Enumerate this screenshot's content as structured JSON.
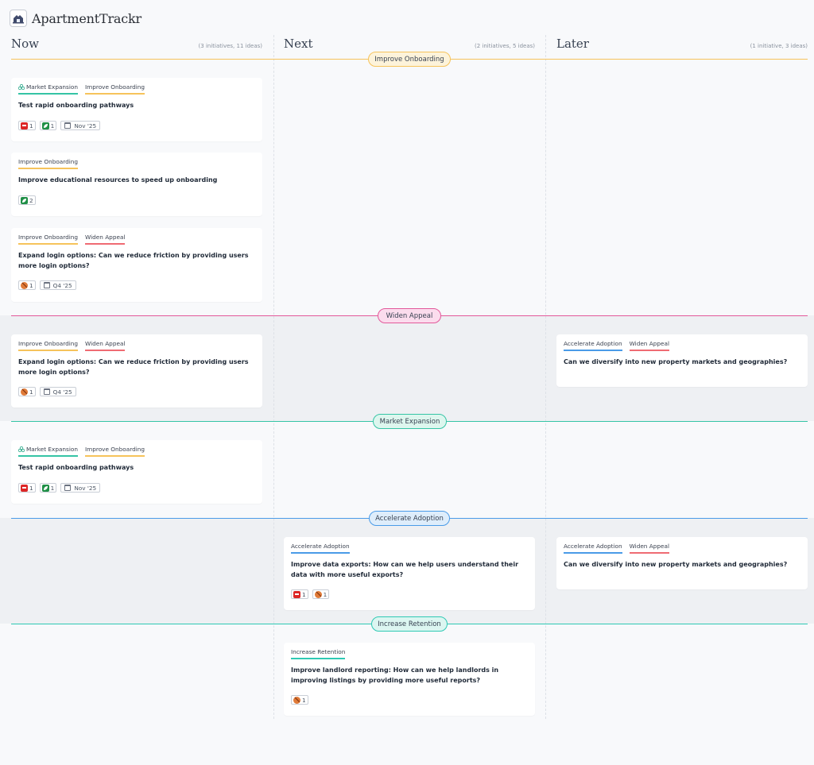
{
  "app": {
    "title": "ApartmentTrackr",
    "logo_icon": "apartment-logo-icon"
  },
  "columns": [
    {
      "title": "Now",
      "summary": "(3 initiatives, 11 ideas)"
    },
    {
      "title": "Next",
      "summary": "(2 initiatives, 5 ideas)"
    },
    {
      "title": "Later",
      "summary": "(1 initiative, 3 ideas)"
    }
  ],
  "colors": {
    "improve_onboarding": "#f6c35b",
    "widen_appeal": "#ef6b73",
    "market_expansion": "#35c4a5",
    "accelerate_adoption": "#4a9be8",
    "increase_retention": "#2ec9b4",
    "blocked": "#dc2626",
    "in_progress": "#1f8f46",
    "risk": "#e07b39"
  },
  "lanes": [
    {
      "label": "Improve Onboarding"
    },
    {
      "label": "Widen Appeal"
    },
    {
      "label": "Market Expansion"
    },
    {
      "label": "Accelerate Adoption"
    },
    {
      "label": "Increase Retention"
    }
  ],
  "cards": [
    {
      "tags": [
        "Market Expansion",
        "Improve Onboarding"
      ],
      "title": "Test rapid onboarding pathways",
      "badges": [
        {
          "icon": "blocked-icon",
          "count": "1"
        },
        {
          "icon": "leaf-icon",
          "count": "1"
        },
        {
          "icon": "calendar-icon",
          "text": "Nov '25"
        }
      ]
    },
    {
      "tags": [
        "Improve Onboarding"
      ],
      "title": "Improve educational resources to speed up onboarding",
      "badges": [
        {
          "icon": "leaf-icon",
          "count": "2"
        }
      ]
    },
    {
      "tags": [
        "Improve Onboarding",
        "Widen Appeal"
      ],
      "title": "Expand login options: Can we reduce friction by providing users more login options?",
      "badges": [
        {
          "icon": "ball-icon",
          "count": "1"
        },
        {
          "icon": "calendar-icon",
          "text": "Q4 '25"
        }
      ]
    },
    {
      "tags": [
        "Improve Onboarding",
        "Widen Appeal"
      ],
      "title": "Expand login options: Can we reduce friction by providing users more login options?",
      "badges": [
        {
          "icon": "ball-icon",
          "count": "1"
        },
        {
          "icon": "calendar-icon",
          "text": "Q4 '25"
        }
      ]
    },
    {
      "tags": [
        "Accelerate Adoption",
        "Widen Appeal"
      ],
      "title": "Can we diversify into new property markets and geographies?",
      "badges": []
    },
    {
      "tags": [
        "Market Expansion",
        "Improve Onboarding"
      ],
      "title": "Test rapid onboarding pathways",
      "badges": [
        {
          "icon": "blocked-icon",
          "count": "1"
        },
        {
          "icon": "leaf-icon",
          "count": "1"
        },
        {
          "icon": "calendar-icon",
          "text": "Nov '25"
        }
      ]
    },
    {
      "tags": [
        "Accelerate Adoption"
      ],
      "title": "Improve data exports: How can we help users understand their data with more useful exports?",
      "badges": [
        {
          "icon": "blocked-icon",
          "count": "1"
        },
        {
          "icon": "ball-icon",
          "count": "1"
        }
      ]
    },
    {
      "tags": [
        "Accelerate Adoption",
        "Widen Appeal"
      ],
      "title": "Can we diversify into new property markets and geographies?",
      "badges": []
    },
    {
      "tags": [
        "Increase Retention"
      ],
      "title": "Improve landlord reporting: How can we help landlords in improving listings by providing more useful reports?",
      "badges": [
        {
          "icon": "ball-icon",
          "count": "1"
        }
      ]
    }
  ]
}
